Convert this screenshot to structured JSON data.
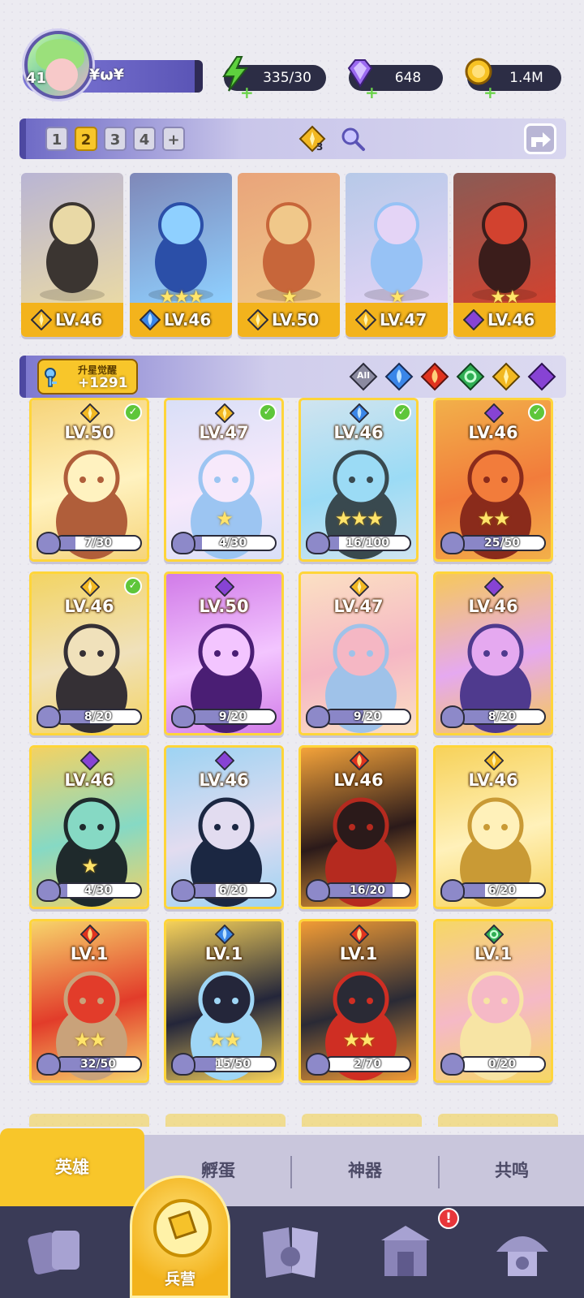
{
  "player": {
    "level": "41",
    "name": "¥ω¥"
  },
  "resources": [
    {
      "icon": "lightning-icon",
      "value": "335/30",
      "color": "#5ed13e"
    },
    {
      "icon": "gem-icon",
      "value": "648",
      "color": "#9b6af0"
    },
    {
      "icon": "gold-coin-icon",
      "value": "1.4M",
      "color": "#f7c224"
    }
  ],
  "team_tabs": [
    "1",
    "2",
    "3",
    "4",
    "+"
  ],
  "active_team": "2",
  "team_counter": "3",
  "team": [
    {
      "level": "LV.46",
      "element": "light",
      "stars": "",
      "palette": [
        "#b9b5d4",
        "#3b3531",
        "#e9d9a6"
      ]
    },
    {
      "level": "LV.46",
      "element": "water",
      "stars": "★★★",
      "palette": [
        "#7f88b8",
        "#2b4fa8",
        "#8fd0ff"
      ]
    },
    {
      "level": "LV.50",
      "element": "light",
      "stars": "★",
      "palette": [
        "#e9a47a",
        "#c7663a",
        "#f0c88a"
      ]
    },
    {
      "level": "LV.47",
      "element": "light",
      "stars": "★",
      "palette": [
        "#b7c9e8",
        "#97c2f5",
        "#e4d4f6"
      ]
    },
    {
      "level": "LV.46",
      "element": "dark",
      "stars": "★★",
      "palette": [
        "#8a5b55",
        "#3b1d1b",
        "#d2422f"
      ]
    }
  ],
  "awaken": {
    "label": "升星觉醒",
    "value": "+1291"
  },
  "filters": [
    {
      "icon": "all-filter-icon",
      "label": "All"
    },
    {
      "icon": "water-filter-icon"
    },
    {
      "icon": "fire-filter-icon"
    },
    {
      "icon": "wind-filter-icon"
    },
    {
      "icon": "light-filter-icon"
    },
    {
      "icon": "dark-filter-icon"
    }
  ],
  "colors": {
    "water": "#3a86e8",
    "fire": "#e0331e",
    "wind": "#2fae54",
    "light": "#f2b822",
    "dark": "#8743d4",
    "accent": "#f8c62a"
  },
  "heroes": [
    {
      "level": "LV.50",
      "element": "light",
      "check": true,
      "stars": "",
      "progress": "7/30",
      "fill": 0.23,
      "palette": [
        "#f6d47a",
        "#b05e3a",
        "#fff2c0"
      ]
    },
    {
      "level": "LV.47",
      "element": "light",
      "check": true,
      "stars": "★",
      "progress": "4/30",
      "fill": 0.13,
      "palette": [
        "#d9dff7",
        "#9cc5f2",
        "#f7e9fb"
      ]
    },
    {
      "level": "LV.46",
      "element": "water",
      "check": true,
      "stars": "★★★",
      "progress": "16/100",
      "fill": 0.16,
      "palette": [
        "#d0e4ef",
        "#39494f",
        "#9bdbf5"
      ]
    },
    {
      "level": "LV.46",
      "element": "dark",
      "check": true,
      "stars": "★★",
      "progress": "25/50",
      "fill": 0.5,
      "palette": [
        "#f2b04a",
        "#8a2b1b",
        "#f27c3b"
      ]
    },
    {
      "level": "LV.46",
      "element": "light",
      "check": true,
      "stars": "",
      "progress": "8/20",
      "fill": 0.4,
      "palette": [
        "#f3d463",
        "#353035",
        "#f0e1bb"
      ]
    },
    {
      "level": "LV.50",
      "element": "dark",
      "check": false,
      "stars": "",
      "progress": "9/20",
      "fill": 0.45,
      "palette": [
        "#d17be8",
        "#4a1e74",
        "#f3c5ff"
      ]
    },
    {
      "level": "LV.47",
      "element": "light",
      "check": false,
      "stars": "",
      "progress": "9/20",
      "fill": 0.45,
      "palette": [
        "#fbe0c3",
        "#9fc2e9",
        "#f5b7c4"
      ]
    },
    {
      "level": "LV.46",
      "element": "dark",
      "check": false,
      "stars": "",
      "progress": "8/20",
      "fill": 0.4,
      "palette": [
        "#f6c85a",
        "#4f3a8e",
        "#e5a9f0"
      ]
    },
    {
      "level": "LV.46",
      "element": "dark",
      "check": false,
      "stars": "★",
      "progress": "4/30",
      "fill": 0.13,
      "palette": [
        "#f3d263",
        "#1f2a2c",
        "#86d9c4"
      ]
    },
    {
      "level": "LV.46",
      "element": "dark",
      "check": false,
      "stars": "",
      "progress": "6/20",
      "fill": 0.3,
      "palette": [
        "#9dd3f3",
        "#1b2742",
        "#e2dcf0"
      ]
    },
    {
      "level": "LV.46",
      "element": "fire",
      "check": false,
      "stars": "",
      "progress": "16/20",
      "fill": 0.8,
      "palette": [
        "#f4a33a",
        "#b52a1f",
        "#2b1a1a"
      ]
    },
    {
      "level": "LV.46",
      "element": "light",
      "check": false,
      "stars": "",
      "progress": "6/20",
      "fill": 0.3,
      "palette": [
        "#f7d25a",
        "#c99a35",
        "#fff1ba"
      ]
    },
    {
      "level": "LV.1",
      "element": "fire",
      "check": false,
      "stars": "★★",
      "progress": "32/50",
      "fill": 0.64,
      "palette": [
        "#f7d46b",
        "#c9a27a",
        "#e23c2a"
      ]
    },
    {
      "level": "LV.1",
      "element": "water",
      "check": false,
      "stars": "★★",
      "progress": "15/50",
      "fill": 0.3,
      "palette": [
        "#f6d15a",
        "#9fd6f6",
        "#24263a"
      ]
    },
    {
      "level": "LV.1",
      "element": "fire",
      "check": false,
      "stars": "★★",
      "progress": "2/70",
      "fill": 0.03,
      "palette": [
        "#f29c35",
        "#cf2e23",
        "#2a2a35"
      ]
    },
    {
      "level": "LV.1",
      "element": "wind",
      "check": false,
      "stars": "",
      "progress": "0/20",
      "fill": 0.0,
      "palette": [
        "#f6d766",
        "#f7e4a4",
        "#f5b9c6"
      ]
    }
  ],
  "tabs": [
    {
      "label": "英雄",
      "active": true
    },
    {
      "label": "孵蛋",
      "active": false
    },
    {
      "label": "神器",
      "active": false
    },
    {
      "label": "共鸣",
      "active": false
    }
  ],
  "nav": [
    {
      "icon": "cards-icon",
      "label": ""
    },
    {
      "icon": "barracks-icon",
      "label": "兵营"
    },
    {
      "icon": "map-book-icon",
      "label": ""
    },
    {
      "icon": "temple-icon",
      "label": ""
    },
    {
      "icon": "mushroom-house-icon",
      "label": ""
    }
  ],
  "nav_alert": "!"
}
